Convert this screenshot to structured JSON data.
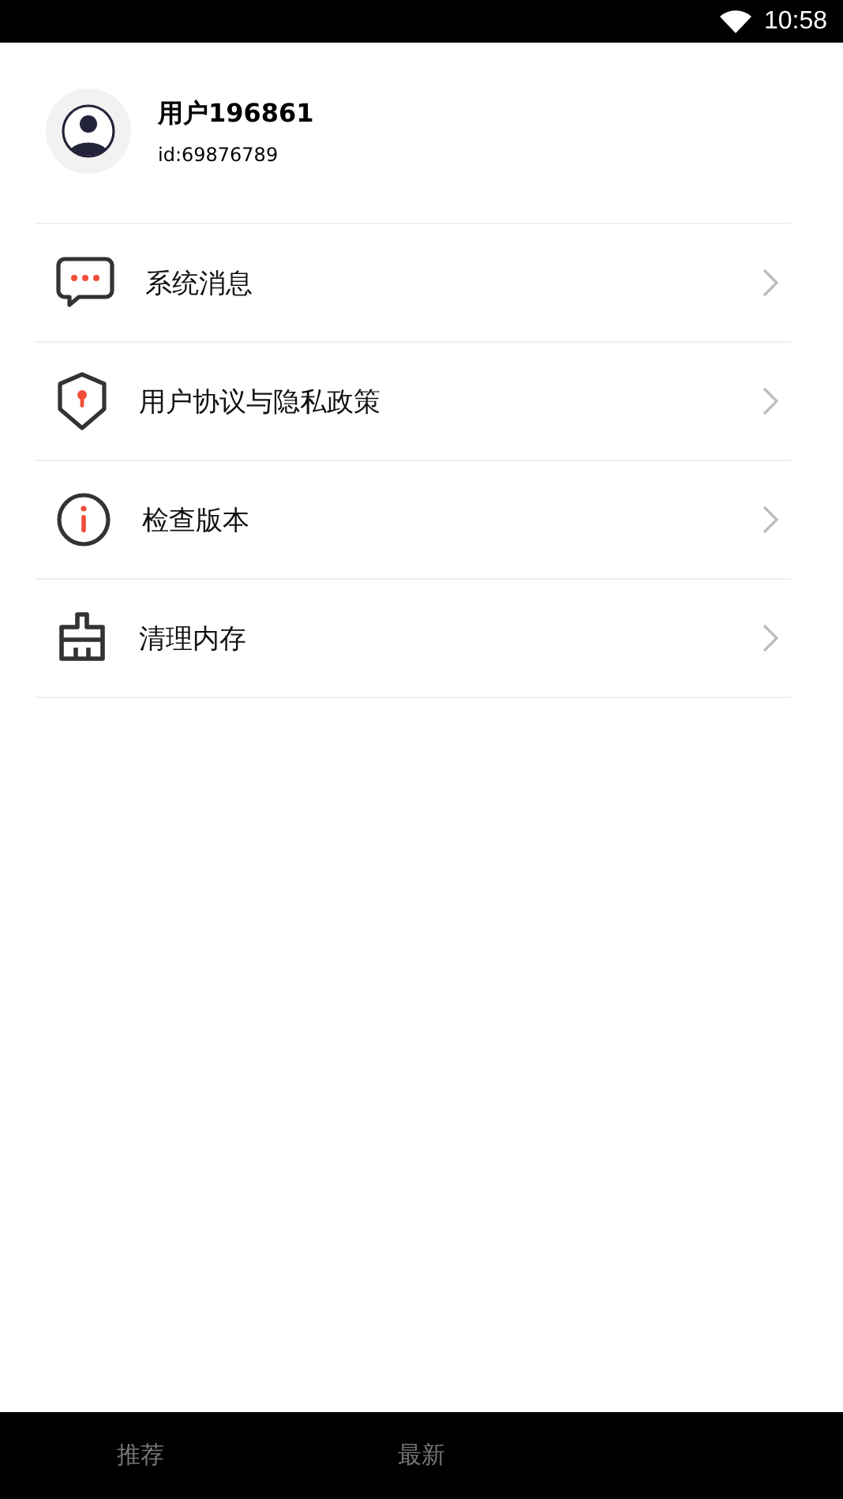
{
  "status_bar": {
    "time": "10:58"
  },
  "profile": {
    "name": "用户196861",
    "id": "id:69876789"
  },
  "menu": [
    {
      "kind": "message",
      "label": "系统消息"
    },
    {
      "kind": "shield",
      "label": "用户协议与隐私政策"
    },
    {
      "kind": "info",
      "label": "检查版本"
    },
    {
      "kind": "broom",
      "label": "清理内存"
    }
  ],
  "tabs": [
    {
      "label": "推荐",
      "selected": false
    },
    {
      "label": "最新",
      "selected": false
    }
  ]
}
